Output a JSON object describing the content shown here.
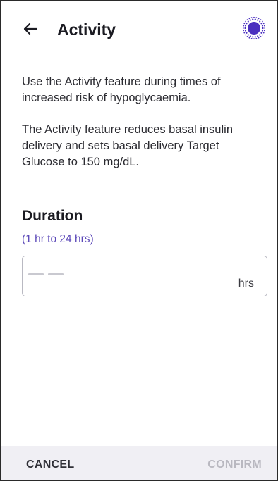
{
  "header": {
    "title": "Activity",
    "back_icon": "arrow-left-icon",
    "status_icon": "dotted-circle-icon",
    "accent_color": "#4a2fbf"
  },
  "body": {
    "paragraph_1": "Use the Activity feature during times of increased risk of hypoglycaemia.",
    "paragraph_2": "The Activity feature reduces basal insulin delivery and sets basal delivery Target Glucose to 150 mg/dL."
  },
  "duration": {
    "title": "Duration",
    "range": "(1 hr to 24 hrs)",
    "value": "",
    "unit": "hrs"
  },
  "footer": {
    "cancel_label": "CANCEL",
    "confirm_label": "CONFIRM",
    "confirm_enabled": false
  }
}
